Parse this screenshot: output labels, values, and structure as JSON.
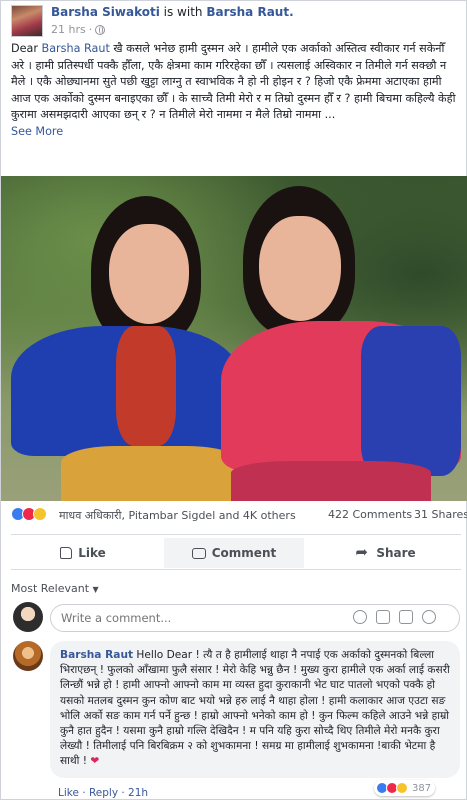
{
  "post": {
    "author": "Barsha Siwakoti",
    "with_text": " is with ",
    "tagged": "Barsha Raut.",
    "time": "21 hrs",
    "dot": "·",
    "text_dear": "Dear ",
    "text_mention": "Barsha Raut",
    "text_body": " खै कसले भनेछ हामी दुस्मन अरे । हामीले एक अर्काको अस्तित्व स्वीकार गर्न सकेनौँ अरे । हामी प्रतिस्पर्धी पक्कै हौँला, एकै क्षेत्रमा काम गरिरहेका छौँ । त्यसलाई अस्विकार न तिमीले गर्न सक्छौ न मैले । एकै ओछ्यानमा सुते पछी खुट्टा लाग्नु त स्वाभविक नै हो नी होइन र ? हिजो एकै फ्रेममा अटाएका हामी आज एक अर्कोको दुस्मन बनाइएका छौँ । के साच्चै तिमी मेरो र म तिम्रो दुस्मन हौँ र ? हामी बिचमा कहिल्यै केही कुरामा असमझदारी आएका छन् र ? न तिमीले मेरो नाममा न मैले तिम्रो नाममा ...",
    "see_more": "See More"
  },
  "reactions": {
    "names": "माधव अधिकारी, Pitambar Sigdel and 4K others",
    "comments": "422 Comments",
    "shares": "31 Shares"
  },
  "actions": {
    "like": "Like",
    "comment": "Comment",
    "share": "Share"
  },
  "comments_section": {
    "sort_label": "Most Relevant",
    "sort_caret": "▼",
    "input_placeholder": "Write a comment..."
  },
  "comment": {
    "author": "Barsha Raut",
    "text": " Hello Dear ! त्यै त है हामीलाई थाहा नै नपाई एक अर्काको दुस्मनको बिल्ला भिराएछन् ! फुलको आँखामा फुलै संसार ! मेरो केहि भन्नु छैन ! मुख्य कुरा हामीले एक अर्का लाई कसरी लिन्छौं भन्ने हो ! हामी आफ्नो आफ्नो काम मा व्यस्त हुदा कुराकानी भेट घाट पातलो भएको पक्कै हो यसको मतलब दुस्मन कुन कोण बाट भयो भन्ने हरु लाई नै थाहा होला ! हामी कलाकार आज एउटा सङ भोलि अर्को सङ काम गर्न पर्ने हुन्छ ! हाम्रो आफ्नो भनेको काम हो ! कुन फिल्म कहिले आउने भन्ने हाम्रो कुनै हात हुदैन ! यसमा कुनै हाम्रो गल्ति देखिदैन ! म पनि यहि कुरा सोच्दै थिए तिमीले मेरो मनकै कुरा लेख्यौ ! तिमीलाई पनि बिरबिक्रम २ को शुभकामना ! समग्र मा हामीलाई शुभकामना !बाकी भेटमा है साथी ! ",
    "heart": "❤",
    "react_count": "387",
    "actions_text": "Like · Reply · 21h"
  }
}
